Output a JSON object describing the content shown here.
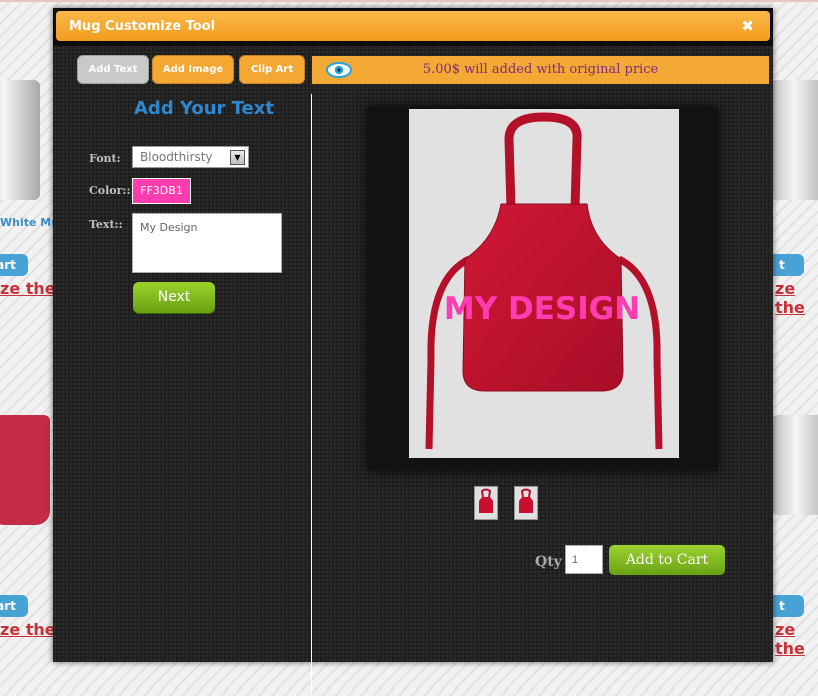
{
  "window": {
    "title": "Mug Customize Tool",
    "close_icon": "✖"
  },
  "tabs": [
    {
      "label": "Add Text",
      "active": true
    },
    {
      "label": "Add Image",
      "active": false
    },
    {
      "label": "Clip Art",
      "active": false
    }
  ],
  "panel": {
    "title": "Add Your Text",
    "font_label": "Font:",
    "font_value": "Bloodthirsty",
    "color_label": "Color::",
    "color_value": "FF3DB1",
    "text_label": "Text::",
    "text_value": "My Design",
    "next_label": "Next"
  },
  "notice": {
    "icon": "eye-icon",
    "text": "5.00$ will added with original price"
  },
  "preview": {
    "design_text": "MY DESIGN",
    "design_color": "#ff3db1",
    "product_color": "#c8102e"
  },
  "purchase": {
    "qty_label": "Qty",
    "qty_value": "1",
    "add_to_cart_label": "Add to Cart"
  },
  "background_page": {
    "left_label": "White Mug",
    "link_text_left": "ze the",
    "link_text_right": "ze the",
    "button_text_left": "art",
    "button_text_right": "t"
  },
  "colors": {
    "accent": "#f4a934",
    "title_blue": "#2d88cf",
    "green": "#7cb51f"
  }
}
